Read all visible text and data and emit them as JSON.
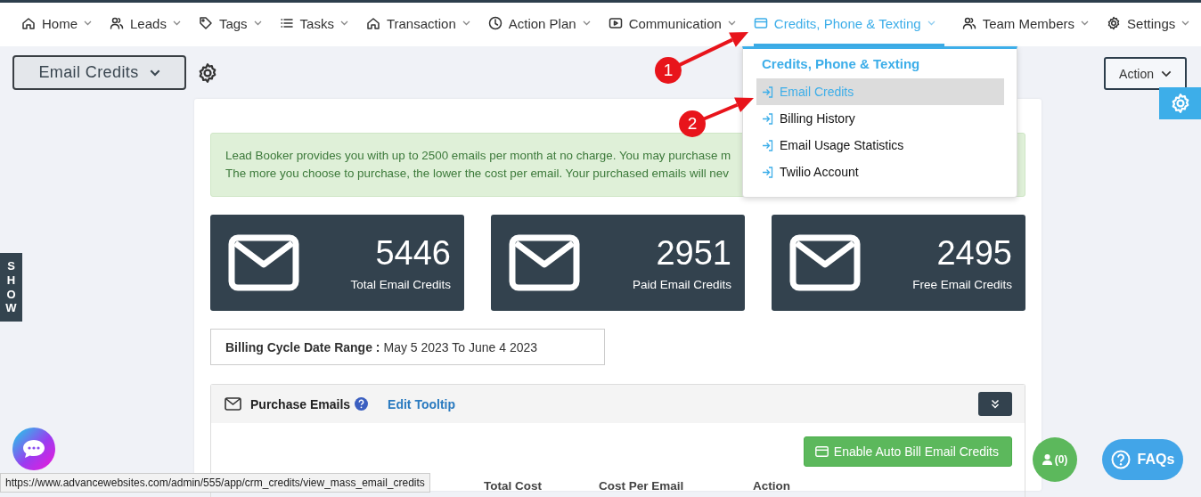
{
  "nav": {
    "items": [
      {
        "label": "Home",
        "selected": false
      },
      {
        "label": "Leads",
        "selected": false
      },
      {
        "label": "Tags",
        "selected": false
      },
      {
        "label": "Tasks",
        "selected": false
      },
      {
        "label": "Transaction",
        "selected": false
      },
      {
        "label": "Action Plan",
        "selected": false
      },
      {
        "label": "Communication",
        "selected": false
      },
      {
        "label": "Credits, Phone & Texting",
        "selected": true
      },
      {
        "label": "Team Members",
        "selected": false
      },
      {
        "label": "Settings",
        "selected": false
      }
    ]
  },
  "toolbar": {
    "page_menu": "Email Credits",
    "action_button": "Action"
  },
  "side_tab": "SHOW",
  "alert": {
    "lines": [
      "Lead Booker provides you with up to 2500 emails per month at no charge. You may purchase m",
      "The more you choose to purchase, the lower the cost per email. Your purchased emails will nev"
    ]
  },
  "stats": [
    {
      "value": "5446",
      "label": "Total Email Credits"
    },
    {
      "value": "2951",
      "label": "Paid Email Credits"
    },
    {
      "value": "2495",
      "label": "Free Email Credits"
    }
  ],
  "billing": {
    "label": "Billing Cycle Date Range :",
    "value": "May 5 2023 To June 4 2023"
  },
  "panel": {
    "title": "Purchase Emails",
    "edit_link": "Edit Tooltip",
    "auto_bill_button": "Enable Auto Bill Email Credits",
    "columns": [
      "Total Cost",
      "Cost Per Email",
      "Action"
    ]
  },
  "dropdown": {
    "title": "Credits, Phone & Texting",
    "items": [
      {
        "label": "Email Credits",
        "selected": true
      },
      {
        "label": "Billing History",
        "selected": false
      },
      {
        "label": "Email Usage Statistics",
        "selected": false
      },
      {
        "label": "Twilio Account",
        "selected": false
      }
    ]
  },
  "annotations": [
    {
      "number": "1"
    },
    {
      "number": "2"
    }
  ],
  "widgets": {
    "contacts_count": "(0)",
    "faq": "FAQs"
  },
  "status_url": "https://www.advancewebsites.com/admin/555/app/crm_credits/view_mass_email_credits"
}
